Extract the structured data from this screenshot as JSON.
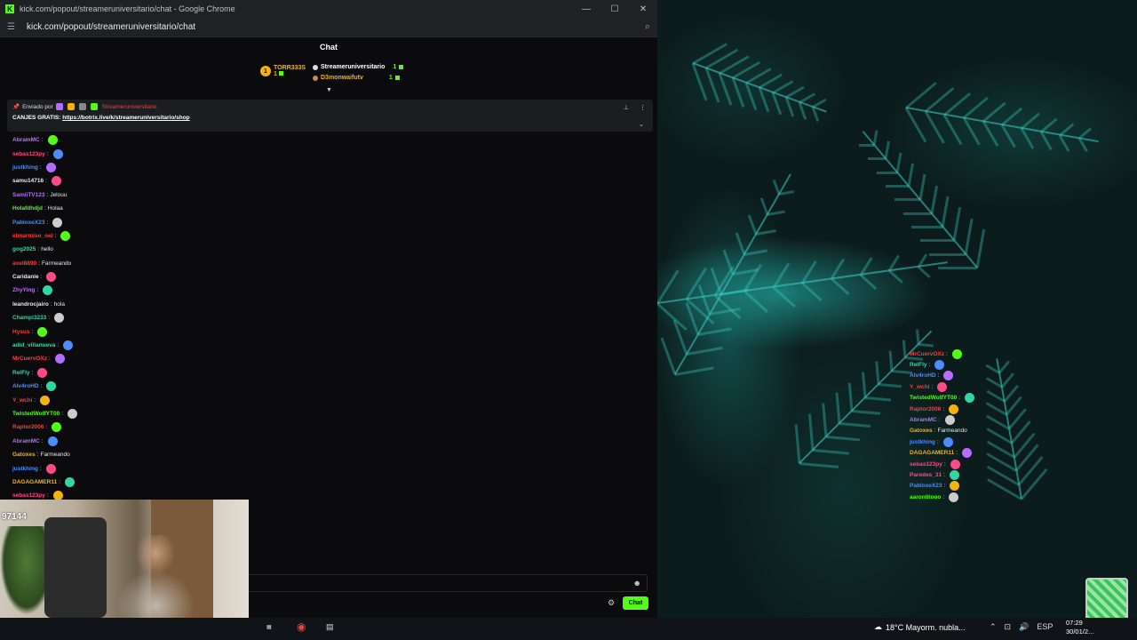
{
  "window": {
    "title": "kick.com/popout/streameruniversitario/chat - Google Chrome",
    "url": "kick.com/popout/streameruniversitario/chat",
    "minimize": "—",
    "maximize": "☐",
    "close": "✕"
  },
  "chat": {
    "header": "Chat",
    "gifters": [
      {
        "name": "TORR333S",
        "count": "1"
      },
      {
        "name": "Streameruniversitario",
        "count": "1"
      },
      {
        "name": "D3monwaifutv",
        "count": "1"
      }
    ],
    "pinned": {
      "sent_by": "Enviado por",
      "author": "Streameruniversitario",
      "label": "CANJES GRATIS:",
      "link": "https://botrix.live/k/streameruniversitario/shop"
    },
    "messages": [
      {
        "user": "AbramMC",
        "text": "",
        "color": "#b56cff"
      },
      {
        "user": "sebas123py",
        "text": "",
        "color": "#ff4a8a"
      },
      {
        "user": "justkhing",
        "text": "",
        "color": "#4d8cff"
      },
      {
        "user": "samu14716",
        "text": "",
        "color": "#e8e8e8"
      },
      {
        "user": "SamiiTV123",
        "text": "Jelouu",
        "color": "#b56cff"
      },
      {
        "user": "Holafdhdjd",
        "text": "Holaa",
        "color": "#53fc18"
      },
      {
        "user": "PabloxeX23",
        "text": "",
        "color": "#4d8cff"
      },
      {
        "user": "elmarmiso_oel",
        "text": "",
        "color": "#ff3b3b"
      },
      {
        "user": "gog2025",
        "text": "hello",
        "color": "#2fd8a3"
      },
      {
        "user": "axel8890",
        "text": "Farmeando",
        "color": "#ff3b3b"
      },
      {
        "user": "Caridanie",
        "text": "",
        "color": "#e8e8e8"
      },
      {
        "user": "ZhyYing",
        "text": "",
        "color": "#b56cff"
      },
      {
        "user": "leandrocjairo",
        "text": "hola",
        "color": "#e8e8e8"
      },
      {
        "user": "Champi3233",
        "text": "",
        "color": "#2fd8a3"
      },
      {
        "user": "Hysus",
        "text": "",
        "color": "#ff3b3b"
      },
      {
        "user": "adid_villanueva",
        "text": "",
        "color": "#2fd8a3"
      },
      {
        "user": "MrCuervOXz",
        "text": "",
        "color": "#ff3b3b"
      },
      {
        "user": "RelFly",
        "text": "",
        "color": "#2fd8a3"
      },
      {
        "user": "Alv4roHD",
        "text": "",
        "color": "#4d8cff"
      },
      {
        "user": "Y_wchi",
        "text": "",
        "color": "#ff3b3b"
      },
      {
        "user": "TwistedWolfYT00",
        "text": "",
        "color": "#53fc18"
      },
      {
        "user": "Raptor2006",
        "text": "",
        "color": "#ff3b3b"
      },
      {
        "user": "AbramMC",
        "text": "",
        "color": "#b56cff"
      },
      {
        "user": "Gatoxes",
        "text": "Farmeando",
        "color": "#f5b30c"
      },
      {
        "user": "justkhing",
        "text": "",
        "color": "#4d8cff"
      },
      {
        "user": "DAGAGAMER11",
        "text": "",
        "color": "#f5b30c"
      },
      {
        "user": "sebas123py",
        "text": "",
        "color": "#ff4a8a"
      }
    ],
    "send_label": "Chat"
  },
  "webcam": {
    "counter": "97144"
  },
  "overlay": {
    "messages": [
      {
        "user": "MrCuervOXz",
        "text": "",
        "color": "#ff3b3b"
      },
      {
        "user": "RelFly",
        "text": "",
        "color": "#2fd8a3"
      },
      {
        "user": "Alv4roHD",
        "text": "",
        "color": "#4d8cff"
      },
      {
        "user": "Y_wchi",
        "text": "",
        "color": "#ff3b3b"
      },
      {
        "user": "TwistedWolfYT00",
        "text": "",
        "color": "#53fc18"
      },
      {
        "user": "Raptor2006",
        "text": "",
        "color": "#ff3b3b"
      },
      {
        "user": "AbramMC",
        "text": "",
        "color": "#b56cff"
      },
      {
        "user": "Gatoxes",
        "text": "Farmeando",
        "color": "#f5b30c"
      },
      {
        "user": "justkhing",
        "text": "",
        "color": "#4d8cff"
      },
      {
        "user": "DAGAGAMER11",
        "text": "",
        "color": "#f5b30c"
      },
      {
        "user": "sebas123py",
        "text": "",
        "color": "#ff4a8a"
      },
      {
        "user": "Paredes_31",
        "text": "",
        "color": "#ff4a8a"
      },
      {
        "user": "PabloxeX23",
        "text": "",
        "color": "#4d8cff"
      },
      {
        "user": "aaronlitooo",
        "text": "",
        "color": "#53fc18"
      }
    ]
  },
  "taskbar": {
    "weather": "18°C  Mayorm. nubla...",
    "lang": "ESP",
    "time": "07:29",
    "date": "30/01/2..."
  },
  "colors": {
    "kick_green": "#53fc18",
    "chat_bg": "#0b0b0d"
  }
}
